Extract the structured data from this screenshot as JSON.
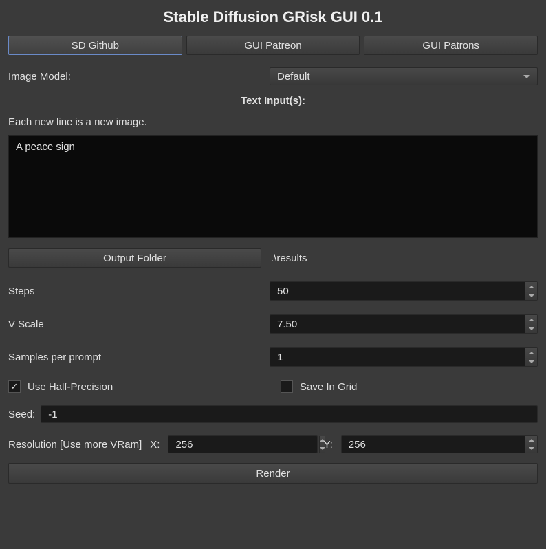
{
  "title": "Stable Diffusion GRisk GUI 0.1",
  "tabs": {
    "github": "SD Github",
    "patreon": "GUI Patreon",
    "patrons": "GUI Patrons"
  },
  "model": {
    "label": "Image Model:",
    "selected": "Default"
  },
  "text_section": {
    "header": "Text Input(s):",
    "hint": "Each new line is a new image.",
    "value": "A peace sign"
  },
  "output": {
    "button": "Output Folder",
    "path": ".\\results"
  },
  "params": {
    "steps": {
      "label": "Steps",
      "value": "50"
    },
    "vscale": {
      "label": "V Scale",
      "value": "7.50"
    },
    "samples": {
      "label": "Samples per prompt",
      "value": "1"
    }
  },
  "checks": {
    "half_precision": "Use Half-Precision",
    "save_grid": "Save In Grid"
  },
  "seed": {
    "label": "Seed:",
    "value": "-1"
  },
  "resolution": {
    "label": "Resolution [Use more VRam]",
    "x_label": "X:",
    "x_value": "256",
    "y_label": "Y:",
    "y_value": "256"
  },
  "render_button": "Render"
}
